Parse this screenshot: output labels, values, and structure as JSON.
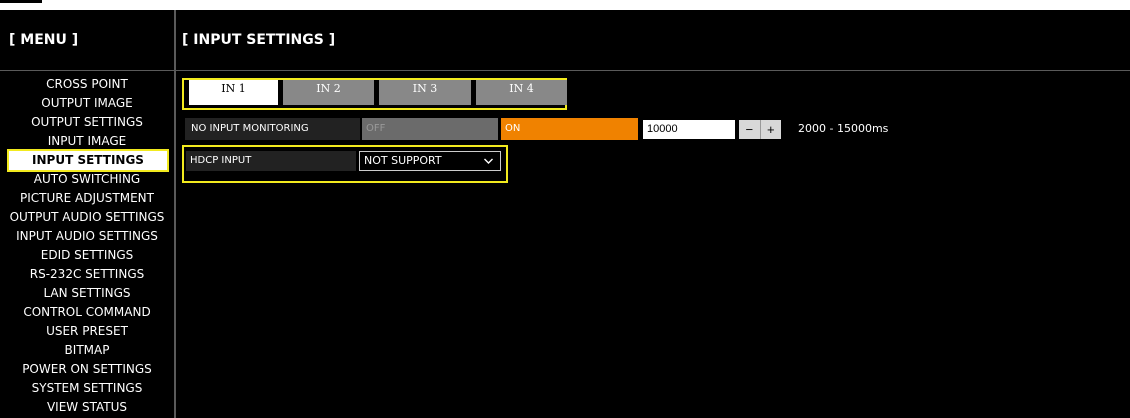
{
  "sidebar": {
    "title": "[ MENU ]",
    "items": [
      {
        "label": "CROSS POINT",
        "active": false
      },
      {
        "label": "OUTPUT IMAGE",
        "active": false
      },
      {
        "label": "OUTPUT SETTINGS",
        "active": false
      },
      {
        "label": "INPUT IMAGE",
        "active": false
      },
      {
        "label": "INPUT SETTINGS",
        "active": true
      },
      {
        "label": "AUTO SWITCHING",
        "active": false
      },
      {
        "label": "PICTURE ADJUSTMENT",
        "active": false
      },
      {
        "label": "OUTPUT AUDIO SETTINGS",
        "active": false
      },
      {
        "label": "INPUT AUDIO SETTINGS",
        "active": false
      },
      {
        "label": "EDID SETTINGS",
        "active": false
      },
      {
        "label": "RS-232C SETTINGS",
        "active": false
      },
      {
        "label": "LAN SETTINGS",
        "active": false
      },
      {
        "label": "CONTROL COMMAND",
        "active": false
      },
      {
        "label": "USER PRESET",
        "active": false
      },
      {
        "label": "BITMAP",
        "active": false
      },
      {
        "label": "POWER ON SETTINGS",
        "active": false
      },
      {
        "label": "SYSTEM SETTINGS",
        "active": false
      },
      {
        "label": "VIEW STATUS",
        "active": false
      }
    ]
  },
  "main": {
    "title": "[ INPUT SETTINGS ]",
    "tabs": [
      {
        "label": "IN 1",
        "selected": true
      },
      {
        "label": "IN 2",
        "selected": false
      },
      {
        "label": "IN 3",
        "selected": false
      },
      {
        "label": "IN 4",
        "selected": false
      }
    ],
    "no_input_monitoring": {
      "label": "NO INPUT MONITORING",
      "off_label": "OFF",
      "on_label": "ON",
      "state": "ON",
      "value": "10000",
      "minus_label": "−",
      "plus_label": "+",
      "range_text": "2000 - 15000ms"
    },
    "hdcp_input": {
      "label": "HDCP INPUT",
      "selected_option": "NOT SUPPORT"
    }
  },
  "colors": {
    "background": "#000000",
    "highlight": "#f2ea1e",
    "on_button": "#f08200",
    "off_button": "#6b6b6b",
    "tab_inactive": "#888888"
  }
}
